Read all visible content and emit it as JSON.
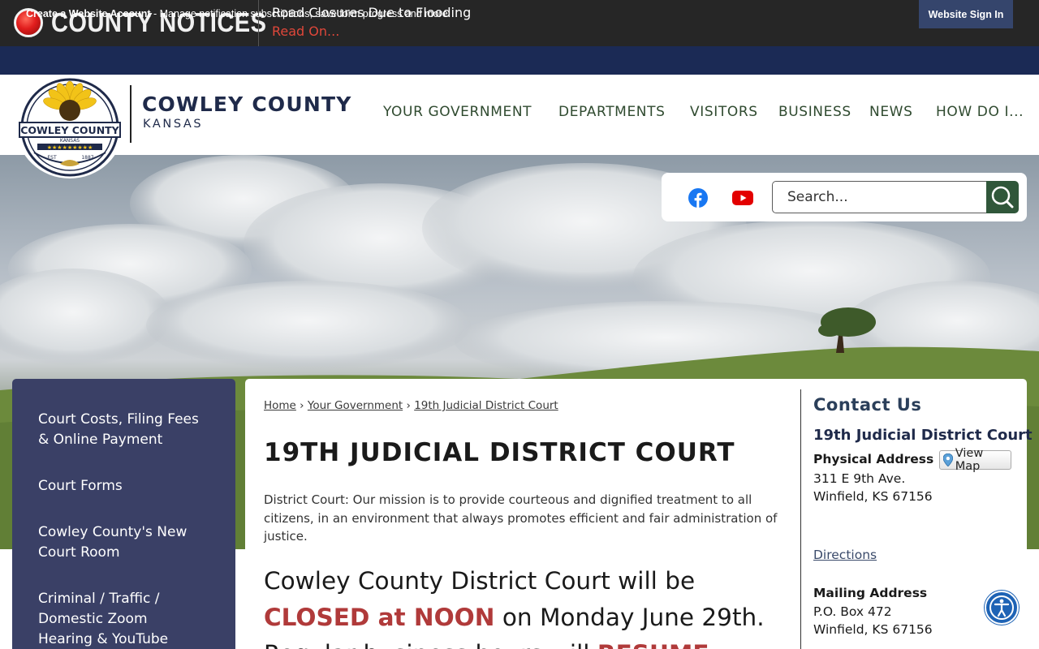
{
  "notice": {
    "title": "COUNTY NOTICES",
    "headline": "Road Closures Due to Flooding",
    "read_on": "Read On..."
  },
  "account_bar": {
    "create_link": "Create a Website Account",
    "description": " - Manage notification subscriptions, save form progress and more.",
    "sign_in": "Website Sign In"
  },
  "header": {
    "brand_name": "COWLEY COUNTY",
    "brand_sub": "KANSAS",
    "seal_text": "COWLEY COUNTY",
    "seal_state": "KANSAS",
    "seal_est": "EST",
    "seal_year": "1887",
    "nav": [
      "YOUR GOVERNMENT",
      "DEPARTMENTS",
      "VISITORS",
      "BUSINESS",
      "NEWS",
      "HOW DO I..."
    ]
  },
  "search": {
    "placeholder": "Search...",
    "icons": [
      "facebook-icon",
      "youtube-icon",
      "search-icon"
    ]
  },
  "sidebar": {
    "items": [
      {
        "label": "Court Costs, Filing Fees & Online Payment"
      },
      {
        "label": "Court Forms"
      },
      {
        "label": "Cowley County's New Court Room"
      },
      {
        "label": "Criminal / Traffic / Domestic Zoom Hearing & YouTube"
      }
    ]
  },
  "breadcrumb": {
    "items": [
      "Home",
      "Your Government",
      "19th Judicial District Court"
    ],
    "separator": "›"
  },
  "main": {
    "title": "19TH JUDICIAL DISTRICT COURT",
    "mission": "District Court: Our mission is to provide courteous and dignified treatment to all citizens, in an environment that always promotes efficient and fair administration of justice.",
    "announcement": {
      "part1": "Cowley County District Court will be",
      "closed": "CLOSED at NOON",
      "part2": " on Monday June 29th.",
      "part3": "Regular business hours will ",
      "resume": "RESUME"
    }
  },
  "contact": {
    "title": "Contact Us",
    "name": "19th Judicial District Court",
    "physical_label": "Physical Address",
    "view_map": "View Map",
    "physical_line1": "311 E 9th Ave.",
    "physical_line2": "Winfield, KS 67156",
    "directions": "Directions",
    "mailing_label": "Mailing Address",
    "mailing_line1": "P.O. Box 472",
    "mailing_line2": "Winfield, KS 67156"
  },
  "colors": {
    "notice_bg": "#262626",
    "account_bar_bg": "#1b2a55",
    "sidebar_bg": "#3a4066",
    "nav_text": "#2f4a2f",
    "search_button": "#30573a",
    "alert_red": "#b03a3a",
    "accessibility_blue": "#1e63b5"
  }
}
